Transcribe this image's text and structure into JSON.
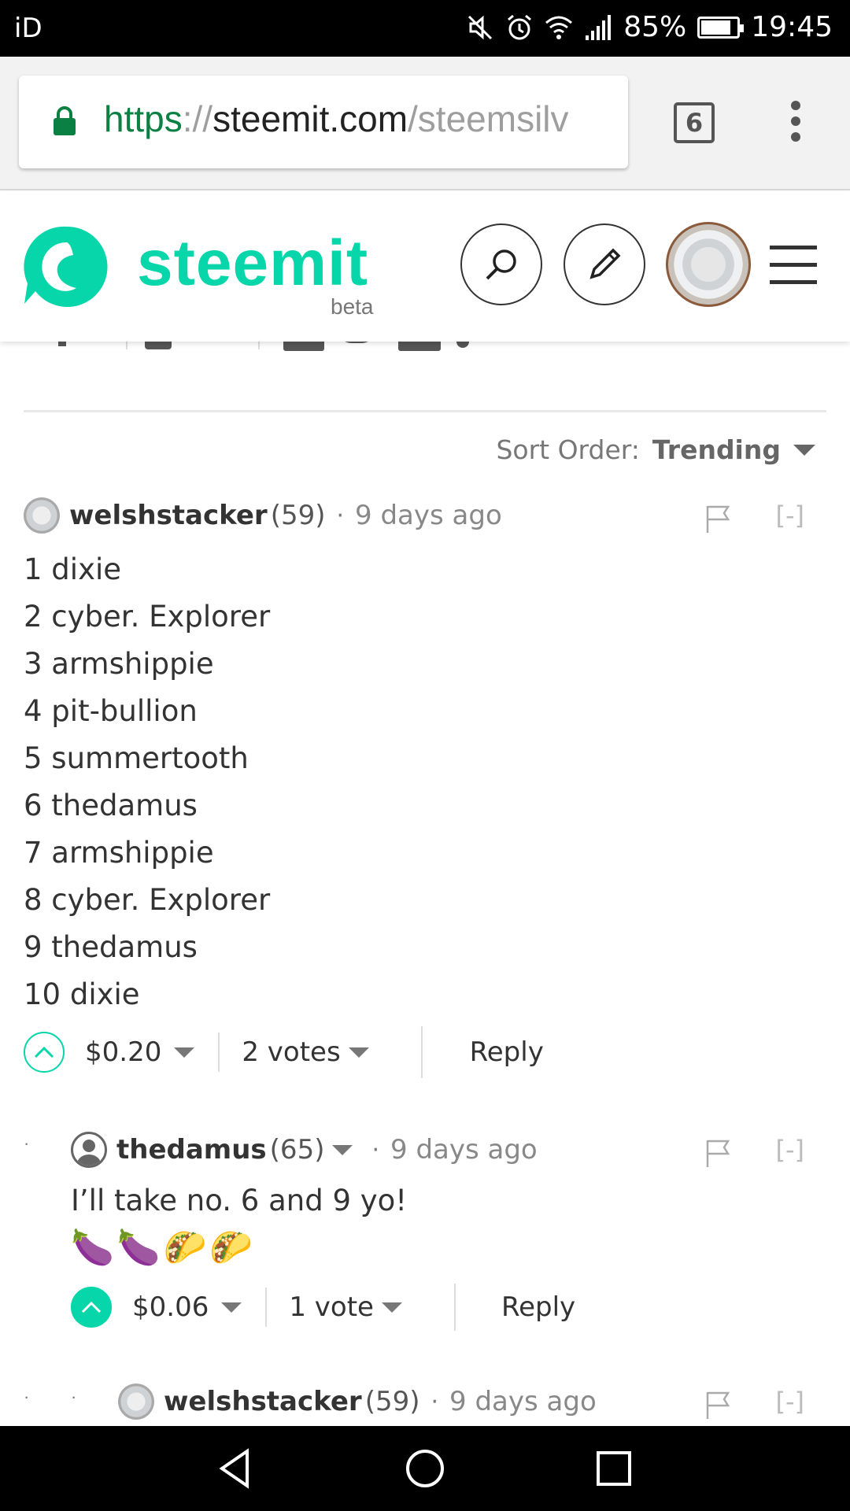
{
  "status_bar": {
    "carrier": "iD",
    "battery": "85%",
    "battery_level": 0.85,
    "time": "19:45",
    "icons": [
      "mute-icon",
      "alarm-icon",
      "wifi-icon",
      "signal-icon",
      "battery-icon"
    ]
  },
  "browser": {
    "url_scheme": "https",
    "url_sep": "://",
    "url_host": "steemit.com",
    "url_path": "/steemsilv",
    "tab_count": "6"
  },
  "site": {
    "logo_text": "steemit",
    "logo_beta": "beta",
    "brand_color": "#06d6a9"
  },
  "sort": {
    "label": "Sort Order:",
    "value": "Trending"
  },
  "comments": [
    {
      "author": "welshstacker",
      "rep": "(59)",
      "dot": "·",
      "time": "9 days ago",
      "collapse": "[-]",
      "body": [
        "1 dixie",
        "2 cyber. Explorer",
        "3 armshippie",
        "4 pit-bullion",
        "5 summertooth",
        "6 thedamus",
        "7 armshippie",
        "8 cyber. Explorer",
        "9 thedamus",
        "10 dixie"
      ],
      "payout": "$0.20",
      "votes": "2 votes",
      "reply": "Reply"
    },
    {
      "author": "thedamus",
      "rep": "(65)",
      "dot": "·",
      "time": "9 days ago",
      "collapse": "[-]",
      "body": [
        "I’ll take no. 6 and 9 yo!"
      ],
      "emoji": "🍆🍆🌮🌮",
      "payout": "$0.06",
      "votes": "1 vote",
      "reply": "Reply"
    },
    {
      "author": "welshstacker",
      "rep": "(59)",
      "dot": "·",
      "time": "9 days ago",
      "collapse": "[-]"
    }
  ],
  "thread_marker": "·"
}
